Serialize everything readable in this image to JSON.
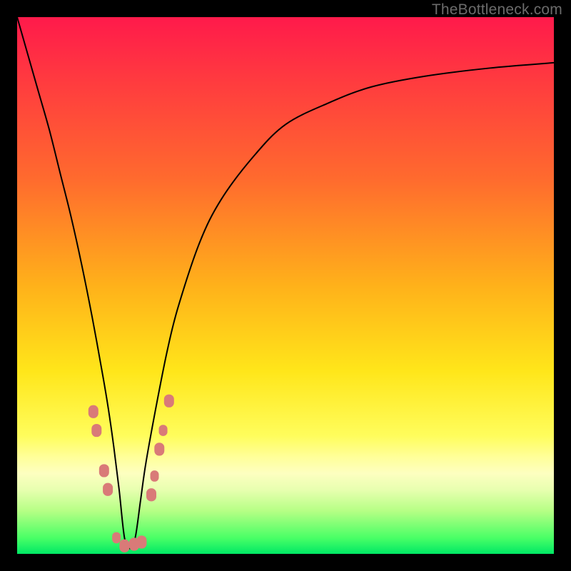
{
  "watermark": "TheBottleneck.com",
  "chart_data": {
    "type": "line",
    "title": "",
    "xlabel": "",
    "ylabel": "",
    "xlim": [
      0,
      100
    ],
    "ylim": [
      0,
      100
    ],
    "gradient_stops": [
      {
        "pct": 0,
        "color": "#ff1a4b"
      },
      {
        "pct": 12,
        "color": "#ff3b3f"
      },
      {
        "pct": 30,
        "color": "#ff6a2e"
      },
      {
        "pct": 50,
        "color": "#ffb11a"
      },
      {
        "pct": 66,
        "color": "#ffe61a"
      },
      {
        "pct": 78,
        "color": "#fffd5c"
      },
      {
        "pct": 82,
        "color": "#ffff9a"
      },
      {
        "pct": 85,
        "color": "#fdffc0"
      },
      {
        "pct": 88,
        "color": "#e8ffb0"
      },
      {
        "pct": 92,
        "color": "#b6ff85"
      },
      {
        "pct": 97,
        "color": "#4aff66"
      },
      {
        "pct": 100,
        "color": "#00e865"
      }
    ],
    "series": [
      {
        "name": "bottleneck-curve",
        "x": [
          0,
          2,
          4,
          6,
          8,
          10,
          12,
          14,
          16,
          17,
          18,
          19,
          20,
          21,
          22,
          23,
          24,
          26,
          28,
          30,
          34,
          38,
          44,
          50,
          58,
          66,
          76,
          88,
          100
        ],
        "y": [
          100,
          93,
          86,
          79,
          71,
          63,
          54,
          44,
          33,
          27,
          20,
          12,
          3,
          1,
          3,
          10,
          17,
          28,
          38,
          46,
          58,
          66,
          74,
          80,
          84,
          87,
          89,
          90.5,
          91.5
        ]
      }
    ],
    "markers": {
      "color": "#d97a78",
      "points": [
        {
          "x": 14.2,
          "y": 26.5,
          "r": 7
        },
        {
          "x": 14.8,
          "y": 23.0,
          "r": 7
        },
        {
          "x": 16.2,
          "y": 15.5,
          "r": 7
        },
        {
          "x": 16.9,
          "y": 12.0,
          "r": 7
        },
        {
          "x": 18.5,
          "y": 3.0,
          "r": 6
        },
        {
          "x": 20.0,
          "y": 1.5,
          "r": 7
        },
        {
          "x": 21.8,
          "y": 1.8,
          "r": 7
        },
        {
          "x": 23.2,
          "y": 2.2,
          "r": 7
        },
        {
          "x": 25.0,
          "y": 11.0,
          "r": 7
        },
        {
          "x": 25.6,
          "y": 14.5,
          "r": 6
        },
        {
          "x": 26.5,
          "y": 19.5,
          "r": 7
        },
        {
          "x": 27.2,
          "y": 23.0,
          "r": 6
        },
        {
          "x": 28.3,
          "y": 28.5,
          "r": 7
        }
      ]
    }
  }
}
